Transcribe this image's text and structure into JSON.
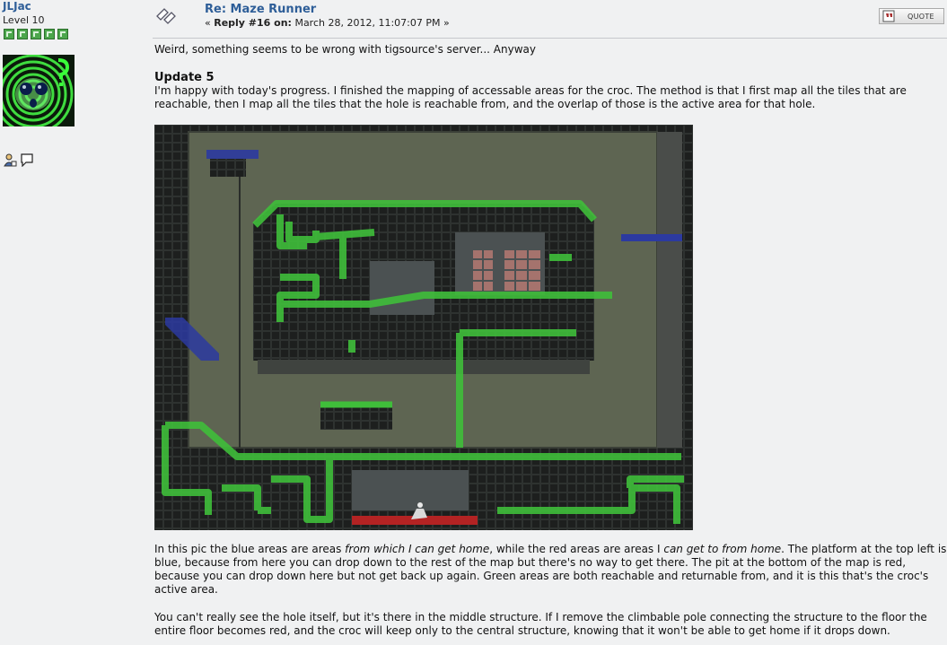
{
  "poster": {
    "name": "JLJac",
    "rank": "Level 10",
    "stars": 5
  },
  "post": {
    "title": "Re: Maze Runner",
    "reply_prefix": "«",
    "reply_label": "Reply #16 on:",
    "reply_date": "March 28, 2012, 11:07:07 PM",
    "reply_suffix": "»",
    "quote_label": "QUOTE"
  },
  "body": {
    "intro": "Weird, something seems to be wrong with tigsource's server... Anyway",
    "heading": "Update 5",
    "para1": "I'm happy with today's progress. I finished the mapping of accessable areas for the croc. The method is that I first map all the tiles that are reachable, then I map all the tiles that the hole is reachable from, and the overlap of those is the active area for that hole.",
    "para2_a": "In this pic the blue areas are areas ",
    "para2_b": "from which I can get home",
    "para2_c": ", while the red areas are areas I ",
    "para2_d": "can get to from home",
    "para2_e": ". The platform at the top left is blue, because from here you can drop down to the rest of the map but there's no way to get there. The pit at the bottom of the map is red, because you can drop down here but not get back up again. Green areas are both reachable and returnable from, and it is this that's the croc's active area.",
    "para3": "You can't really see the hole itself, but it's there in the middle structure. If I remove the climbable pole connecting the structure to the floor the entire floor becomes red, and the croc will keep only to the central structure, knowing that it won't be able to get home if it drops down."
  }
}
